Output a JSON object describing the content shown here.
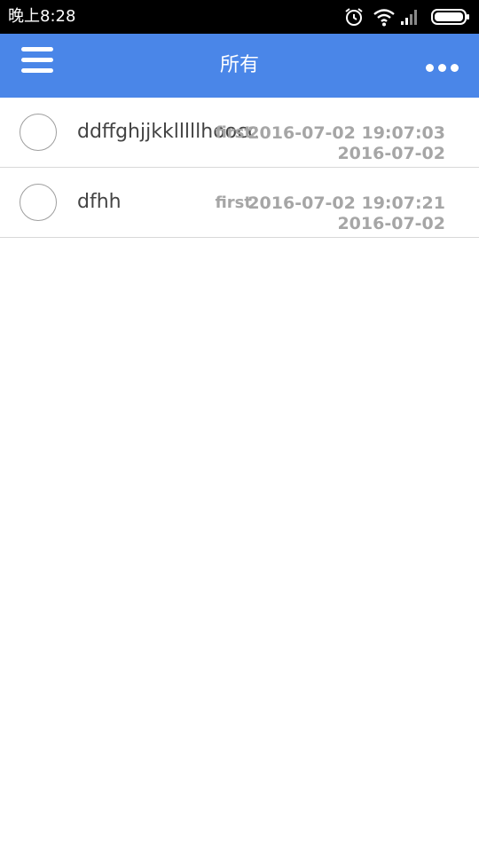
{
  "status_bar": {
    "time": "晚上8:28",
    "icons": [
      "alarm-icon",
      "wifi-icon",
      "signal-icon",
      "battery-icon"
    ]
  },
  "app_bar": {
    "title": "所有",
    "menu_icon": "menu-icon",
    "more_icon": "more-icon",
    "background": "#4a86e8"
  },
  "tasks": [
    {
      "title": "ddffghjjkklllllhoocc",
      "category": "first",
      "datetime": "2016-07-02 19:07:03",
      "date": "2016-07-02"
    },
    {
      "title": "dfhh",
      "category": "first",
      "datetime": "2016-07-02 19:07:21",
      "date": "2016-07-02"
    }
  ]
}
